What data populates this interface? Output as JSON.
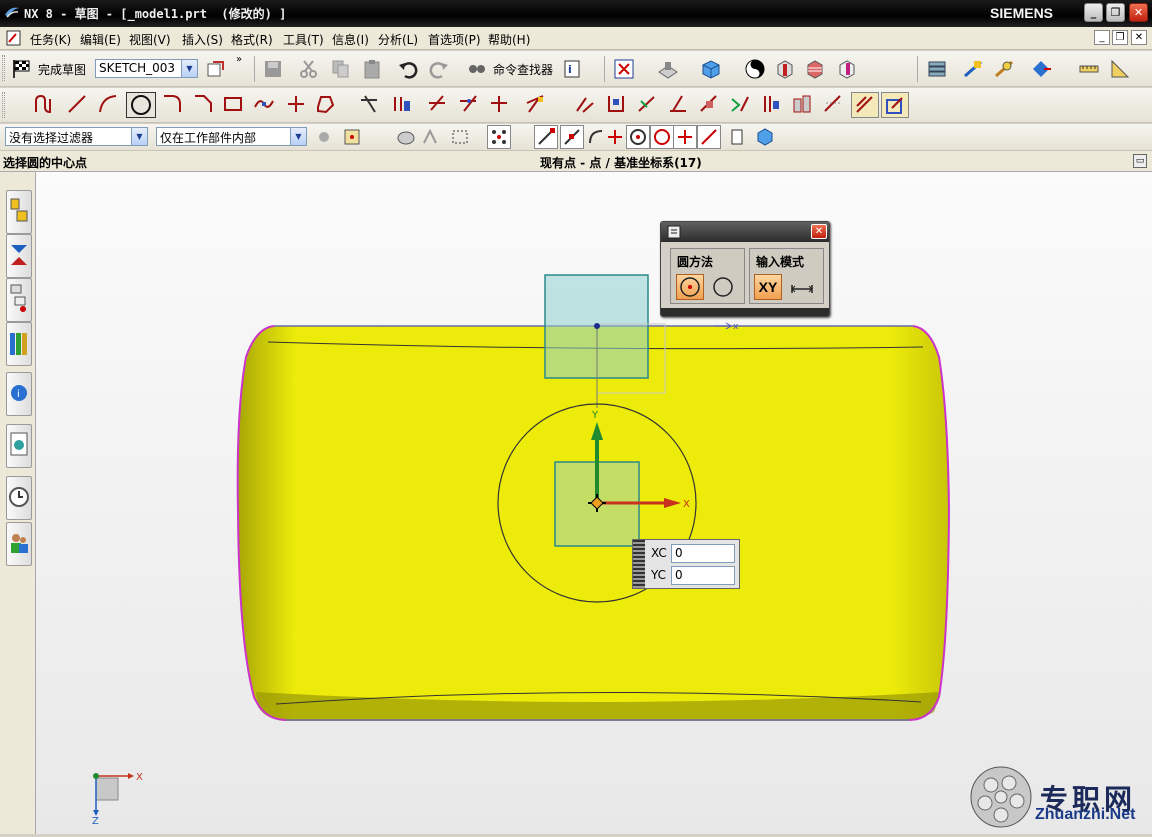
{
  "window": {
    "title": "NX 8 - 草图 - [_model1.prt  (修改的) ]",
    "brand": "SIEMENS"
  },
  "menu": [
    {
      "label": "任务(K)"
    },
    {
      "label": "编辑(E)"
    },
    {
      "label": "视图(V)"
    },
    {
      "label": "插入(S)"
    },
    {
      "label": "格式(R)"
    },
    {
      "label": "工具(T)"
    },
    {
      "label": "信息(I)"
    },
    {
      "label": "分析(L)"
    },
    {
      "label": "首选项(P)"
    },
    {
      "label": "帮助(H)"
    }
  ],
  "toolbar1": {
    "finish_sketch": "完成草图",
    "sketch_name": "SKETCH_003",
    "command_finder": "命令查找器"
  },
  "toolbar3": {
    "selection_filter": "没有选择过滤器",
    "scope": "仅在工作部件内部"
  },
  "cue": {
    "prompt": "选择圆的中心点",
    "status": "现有点 - 点 / 基准坐标系(17)"
  },
  "circle_dialog": {
    "method_title": "圆方法",
    "input_mode_title": "输入模式",
    "xy_label": "XY"
  },
  "coord_input": {
    "xc_label": "XC",
    "xc_value": "0",
    "yc_label": "YC",
    "yc_value": "0"
  },
  "axis_labels": {
    "x": "X",
    "y": "Y",
    "z": "Z"
  },
  "watermark": {
    "cn": "专职网",
    "url": "Zhuanzhi.Net"
  },
  "colors": {
    "body": "#ecea0a",
    "selection_square": "#3a9a9a",
    "edge": "#cc33cc"
  }
}
